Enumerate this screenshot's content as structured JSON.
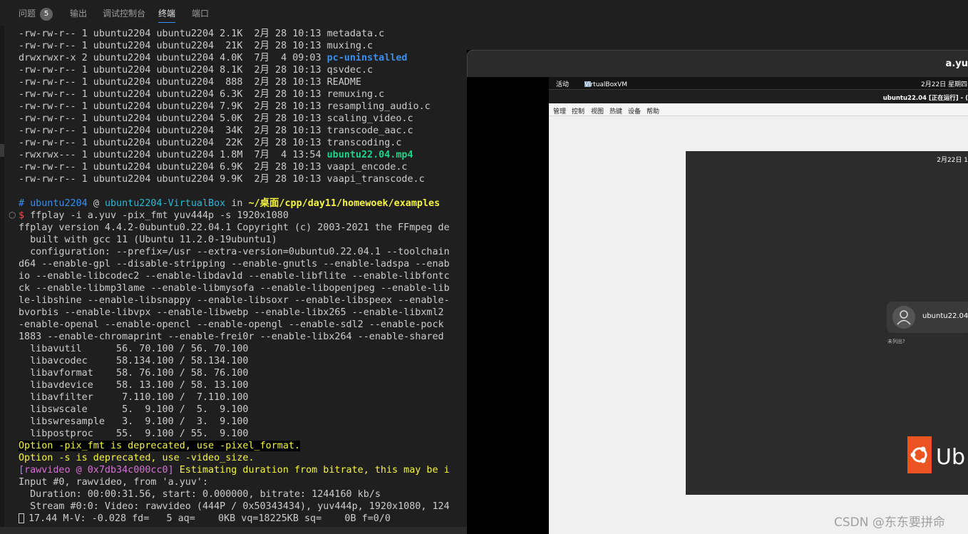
{
  "tabs": [
    {
      "label": "问题",
      "badge": "5"
    },
    {
      "label": "输出"
    },
    {
      "label": "调试控制台"
    },
    {
      "label": "终端",
      "active": true
    },
    {
      "label": "端口"
    }
  ],
  "terminal": {
    "listing": [
      {
        "perm": "-rw-rw-r--",
        "links": "1",
        "user": "ubuntu2204",
        "group": "ubuntu2204",
        "size": "2.1K",
        "month": "2月",
        "day": "28",
        "time": "10:13",
        "name": "metadata.c",
        "kind": "file"
      },
      {
        "perm": "-rw-rw-r--",
        "links": "1",
        "user": "ubuntu2204",
        "group": "ubuntu2204",
        "size": " 21K",
        "month": "2月",
        "day": "28",
        "time": "10:13",
        "name": "muxing.c",
        "kind": "file"
      },
      {
        "perm": "drwxrwxr-x",
        "links": "2",
        "user": "ubuntu2204",
        "group": "ubuntu2204",
        "size": "4.0K",
        "month": "7月",
        "day": " 4",
        "time": "09:03",
        "name": "pc-uninstalled",
        "kind": "dir"
      },
      {
        "perm": "-rw-rw-r--",
        "links": "1",
        "user": "ubuntu2204",
        "group": "ubuntu2204",
        "size": "8.1K",
        "month": "2月",
        "day": "28",
        "time": "10:13",
        "name": "qsvdec.c",
        "kind": "file"
      },
      {
        "perm": "-rw-rw-r--",
        "links": "1",
        "user": "ubuntu2204",
        "group": "ubuntu2204",
        "size": " 888",
        "month": "2月",
        "day": "28",
        "time": "10:13",
        "name": "README",
        "kind": "file"
      },
      {
        "perm": "-rw-rw-r--",
        "links": "1",
        "user": "ubuntu2204",
        "group": "ubuntu2204",
        "size": "6.3K",
        "month": "2月",
        "day": "28",
        "time": "10:13",
        "name": "remuxing.c",
        "kind": "file"
      },
      {
        "perm": "-rw-rw-r--",
        "links": "1",
        "user": "ubuntu2204",
        "group": "ubuntu2204",
        "size": "7.9K",
        "month": "2月",
        "day": "28",
        "time": "10:13",
        "name": "resampling_audio.c",
        "kind": "file"
      },
      {
        "perm": "-rw-rw-r--",
        "links": "1",
        "user": "ubuntu2204",
        "group": "ubuntu2204",
        "size": "5.0K",
        "month": "2月",
        "day": "28",
        "time": "10:13",
        "name": "scaling_video.c",
        "kind": "file"
      },
      {
        "perm": "-rw-rw-r--",
        "links": "1",
        "user": "ubuntu2204",
        "group": "ubuntu2204",
        "size": " 34K",
        "month": "2月",
        "day": "28",
        "time": "10:13",
        "name": "transcode_aac.c",
        "kind": "file"
      },
      {
        "perm": "-rw-rw-r--",
        "links": "1",
        "user": "ubuntu2204",
        "group": "ubuntu2204",
        "size": " 22K",
        "month": "2月",
        "day": "28",
        "time": "10:13",
        "name": "transcoding.c",
        "kind": "file"
      },
      {
        "perm": "-rwxrwx---",
        "links": "1",
        "user": "ubuntu2204",
        "group": "ubuntu2204",
        "size": "1.8M",
        "month": "7月",
        "day": " 4",
        "time": "13:54",
        "name": "ubuntu22.04.mp4",
        "kind": "exe"
      },
      {
        "perm": "-rw-rw-r--",
        "links": "1",
        "user": "ubuntu2204",
        "group": "ubuntu2204",
        "size": "6.9K",
        "month": "2月",
        "day": "28",
        "time": "10:13",
        "name": "vaapi_encode.c",
        "kind": "file"
      },
      {
        "perm": "-rw-rw-r--",
        "links": "1",
        "user": "ubuntu2204",
        "group": "ubuntu2204",
        "size": "9.9K",
        "month": "2月",
        "day": "28",
        "time": "10:13",
        "name": "vaapi_transcode.c",
        "kind": "file"
      }
    ],
    "prompt": {
      "hash": "#",
      "user": "ubuntu2204",
      "at": "@",
      "host": "ubuntu2204-VirtualBox",
      "in": "in",
      "path": "~/桌面/cpp/day11/homewoek/examples",
      "dollar": "$",
      "command": "ffplay -i a.yuv -pix_fmt yuv444p -s 1920x1080",
      "gutter": "○"
    },
    "output": [
      "ffplay version 4.4.2-0ubuntu0.22.04.1 Copyright (c) 2003-2021 the FFmpeg de",
      "  built with gcc 11 (Ubuntu 11.2.0-19ubuntu1)",
      "  configuration: --prefix=/usr --extra-version=0ubuntu0.22.04.1 --toolchain",
      "d64 --enable-gpl --disable-stripping --enable-gnutls --enable-ladspa --enab",
      "io --enable-libcodec2 --enable-libdav1d --enable-libflite --enable-libfontc",
      "ck --enable-libmp3lame --enable-libmysofa --enable-libopenjpeg --enable-lib",
      "le-libshine --enable-libsnappy --enable-libsoxr --enable-libspeex --enable-",
      "bvorbis --enable-libvpx --enable-libwebp --enable-libx265 --enable-libxml2 ",
      "-enable-openal --enable-opencl --enable-opengl --enable-sdl2 --enable-pock",
      "1883 --enable-chromaprint --enable-frei0r --enable-libx264 --enable-shared",
      "  libavutil      56. 70.100 / 56. 70.100",
      "  libavcodec     58.134.100 / 58.134.100",
      "  libavformat    58. 76.100 / 58. 76.100",
      "  libavdevice    58. 13.100 / 58. 13.100",
      "  libavfilter     7.110.100 /  7.110.100",
      "  libswscale      5.  9.100 /  5.  9.100",
      "  libswresample   3.  9.100 /  3.  9.100",
      "  libpostproc    55.  9.100 / 55.  9.100"
    ],
    "warn1": "Option -pix_fmt is deprecated, use -pixel_format.",
    "warn2": "Option -s is deprecated, use -video_size.",
    "rawvideo_tag": "[rawvideo @ 0x7db34c000cc0]",
    "rawvideo_msg": " Estimating duration from bitrate, this may be i",
    "input_lines": [
      "Input #0, rawvideo, from 'a.yuv':",
      "  Duration: 00:00:31.56, start: 0.000000, bitrate: 1244160 kb/s",
      "  Stream #0:0: Video: rawvideo (444P / 0x50343434), yuv444p, 1920x1080, 124"
    ],
    "status": "17.44 M-V: -0.028 fd=   5 aq=    0KB vq=18225KB sq=    0B f=0/0"
  },
  "vbox": {
    "window_title": "a.yu",
    "gnome_activities": "活动",
    "gnome_app": "VirtualBoxVM",
    "gnome_clock": "2月22日 星期四",
    "vm_title": "ubuntu22.04 [正在运行] - (",
    "menu": [
      "管理",
      "控制",
      "视图",
      "热键",
      "设备",
      "帮助"
    ],
    "guest_clock": "2月22日 1",
    "user_name": "ubuntu22.04",
    "not_listed": "未列出?",
    "brand_text": "Ub",
    "brand_color": "#e95420"
  },
  "watermark": "CSDN @东东要拼命"
}
